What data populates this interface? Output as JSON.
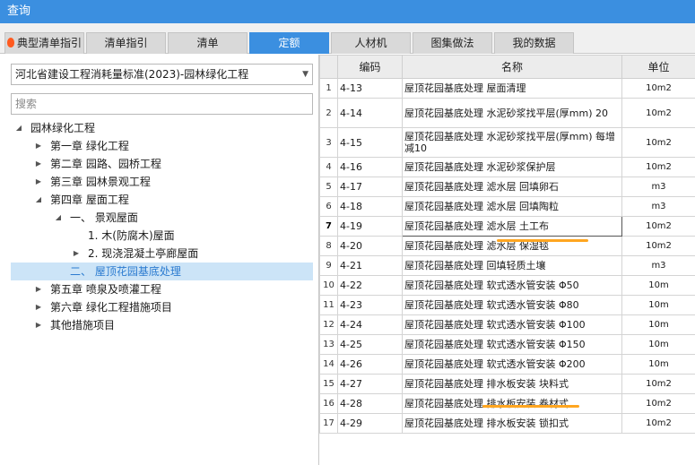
{
  "window": {
    "title": "查询"
  },
  "tabs": [
    {
      "label": "典型清单指引",
      "icon": "flame-icon",
      "active": false
    },
    {
      "label": "清单指引",
      "active": false
    },
    {
      "label": "清单",
      "active": false
    },
    {
      "label": "定额",
      "active": true
    },
    {
      "label": "人材机",
      "active": false
    },
    {
      "label": "图集做法",
      "active": false
    },
    {
      "label": "我的数据",
      "active": false
    }
  ],
  "library_select": {
    "value": "河北省建设工程消耗量标准(2023)-园林绿化工程"
  },
  "search": {
    "placeholder": "搜索"
  },
  "tree": [
    {
      "label": "园林绿化工程",
      "level": 0,
      "toggle": "expanded"
    },
    {
      "label": "第一章 绿化工程",
      "level": 1,
      "toggle": "collapsed"
    },
    {
      "label": "第二章 园路、园桥工程",
      "level": 1,
      "toggle": "collapsed"
    },
    {
      "label": "第三章 园林景观工程",
      "level": 1,
      "toggle": "collapsed"
    },
    {
      "label": "第四章 屋面工程",
      "level": 1,
      "toggle": "expanded"
    },
    {
      "label": "一、 景观屋面",
      "level": 2,
      "toggle": "expanded"
    },
    {
      "label": "1. 木(防腐木)屋面",
      "level": 3,
      "toggle": "none"
    },
    {
      "label": "2. 现浇混凝土亭廊屋面",
      "level": 3,
      "toggle": "collapsed"
    },
    {
      "label": "二、 屋顶花园基底处理",
      "level": 2,
      "toggle": "none",
      "selected": true
    },
    {
      "label": "第五章 喷泉及喷灌工程",
      "level": 1,
      "toggle": "collapsed"
    },
    {
      "label": "第六章 绿化工程措施项目",
      "level": 1,
      "toggle": "collapsed"
    },
    {
      "label": "其他措施项目",
      "level": 1,
      "toggle": "collapsed"
    }
  ],
  "grid": {
    "columns": [
      "编码",
      "名称",
      "单位"
    ],
    "rows": [
      {
        "num": "1",
        "code": "4-13",
        "name": "屋顶花园基底处理 屋面清理",
        "unit": "10m2"
      },
      {
        "num": "2",
        "code": "4-14",
        "name": "屋顶花园基底处理 水泥砂浆找平层(厚mm) 20",
        "unit": "10m2"
      },
      {
        "num": "3",
        "code": "4-15",
        "name": "屋顶花园基底处理 水泥砂浆找平层(厚mm) 每增减10",
        "unit": "10m2"
      },
      {
        "num": "4",
        "code": "4-16",
        "name": "屋顶花园基底处理 水泥砂浆保护层",
        "unit": "10m2"
      },
      {
        "num": "5",
        "code": "4-17",
        "name": "屋顶花园基底处理 滤水层 回填卵石",
        "unit": "m3"
      },
      {
        "num": "6",
        "code": "4-18",
        "name": "屋顶花园基底处理 滤水层 回填陶粒",
        "unit": "m3"
      },
      {
        "num": "7",
        "code": "4-19",
        "name": "屋顶花园基底处理 滤水层 土工布",
        "unit": "10m2",
        "selected": true
      },
      {
        "num": "8",
        "code": "4-20",
        "name": "屋顶花园基底处理 滤水层 保湿毯",
        "unit": "10m2"
      },
      {
        "num": "9",
        "code": "4-21",
        "name": "屋顶花园基底处理 回填轻质土壤",
        "unit": "m3"
      },
      {
        "num": "10",
        "code": "4-22",
        "name": "屋顶花园基底处理 软式透水管安装 Φ50",
        "unit": "10m"
      },
      {
        "num": "11",
        "code": "4-23",
        "name": "屋顶花园基底处理 软式透水管安装 Φ80",
        "unit": "10m"
      },
      {
        "num": "12",
        "code": "4-24",
        "name": "屋顶花园基底处理 软式透水管安装 Φ100",
        "unit": "10m"
      },
      {
        "num": "13",
        "code": "4-25",
        "name": "屋顶花园基底处理 软式透水管安装 Φ150",
        "unit": "10m"
      },
      {
        "num": "14",
        "code": "4-26",
        "name": "屋顶花园基底处理 软式透水管安装 Φ200",
        "unit": "10m"
      },
      {
        "num": "15",
        "code": "4-27",
        "name": "屋顶花园基底处理 排水板安装 块料式",
        "unit": "10m2"
      },
      {
        "num": "16",
        "code": "4-28",
        "name": "屋顶花园基底处理 排水板安装 卷材式",
        "unit": "10m2"
      },
      {
        "num": "17",
        "code": "4-29",
        "name": "屋顶花园基底处理 排水板安装 锁扣式",
        "unit": "10m2"
      }
    ]
  },
  "colors": {
    "accent": "#3b8fe0",
    "highlight": "#ffa620",
    "tree_selection": "#cce4f7"
  }
}
